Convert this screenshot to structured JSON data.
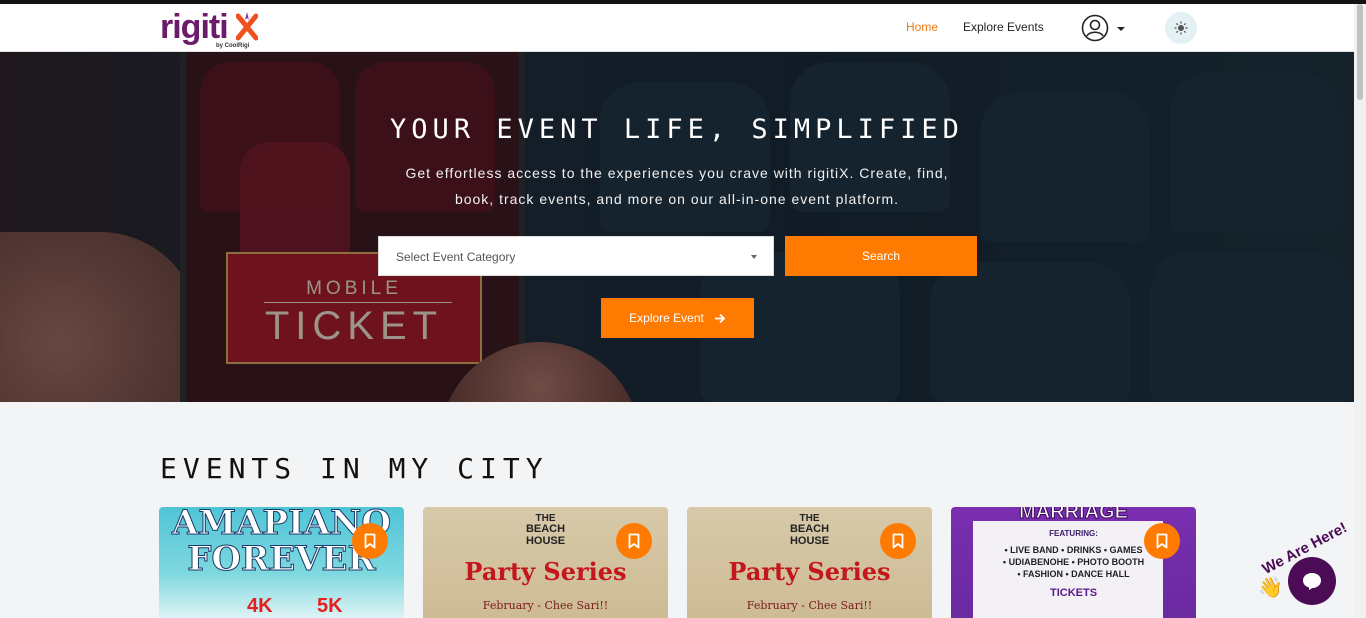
{
  "brand": {
    "name": "rigiti",
    "name_x": "X",
    "byline": "by CoolRigi"
  },
  "nav": {
    "home": "Home",
    "explore": "Explore Events"
  },
  "hero": {
    "title": "YOUR EVENT LIFE, SIMPLIFIED",
    "subtitle": "Get effortless access to the experiences you crave with rigitiX. Create, find, book, track events, and more on our all-in-one event platform.",
    "ticket_top": "MOBILE",
    "ticket_main": "TICKET",
    "select_placeholder": "Select Event Category",
    "search_label": "Search",
    "explore_label": "Explore Event"
  },
  "section": {
    "title": "EVENTS IN MY CITY"
  },
  "cards": [
    {
      "title_line1": "AMAPIANO",
      "title_line2": "FOREVER",
      "price1": "4K",
      "price2": "5K"
    },
    {
      "venue_line1": "THE",
      "venue_line2": "BEACH",
      "venue_line3": "HOUSE",
      "title": "Party Series",
      "subtitle": "February - Chee Sari!!"
    },
    {
      "venue_line1": "THE",
      "venue_line2": "BEACH",
      "venue_line3": "HOUSE",
      "title": "Party Series",
      "subtitle": "February - Chee Sari!!"
    },
    {
      "title": "MARRIAGE",
      "features_label": "FEATURING:",
      "features": "• LIVE BAND • DRINKS • GAMES",
      "features2": "• UDIABENOHE • PHOTO BOOTH",
      "features3": "• FASHION • DANCE HALL",
      "tickets": "TICKETS"
    }
  ],
  "chat": {
    "tag": "We Are Here!"
  },
  "colors": {
    "accent": "#ff7a00",
    "brand": "#6a1b6a",
    "chat": "#4b0b55"
  }
}
